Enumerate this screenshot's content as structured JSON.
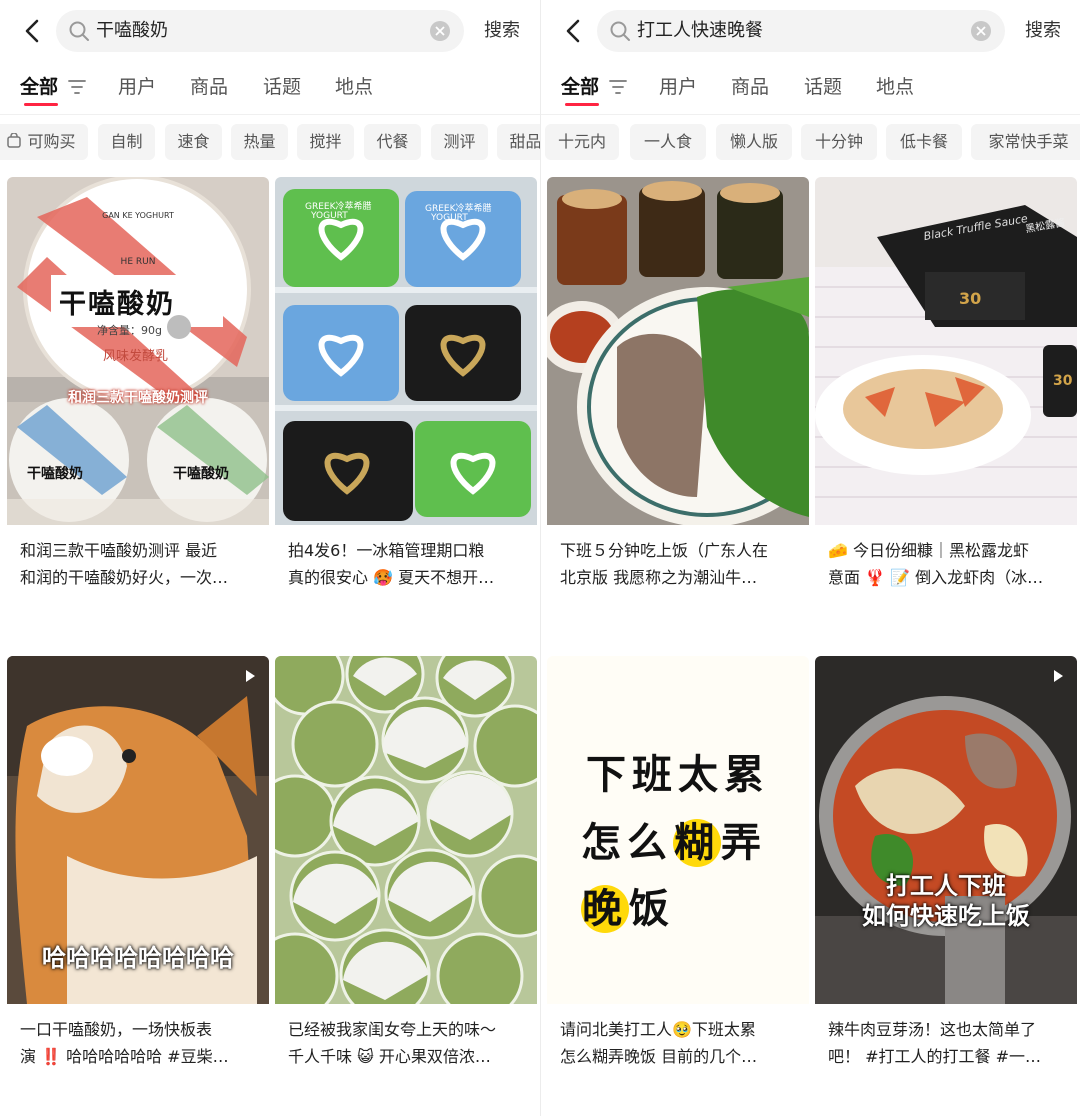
{
  "left": {
    "query": "干嗑酸奶",
    "search_label": "搜索",
    "tabs": [
      "全部",
      "用户",
      "商品",
      "话题",
      "地点"
    ],
    "chips": [
      "可购买",
      "自制",
      "速食",
      "热量",
      "搅拌",
      "代餐",
      "测评",
      "甜品"
    ],
    "cards": [
      {
        "title": "和润三款干嗑酸奶测评 最近\n和润的干嗑酸奶好火，一次…",
        "overlay": {
          "lid_main": "干嗑酸奶",
          "lid_en": "GAN KE YOGHURT",
          "brand": "HE RUN",
          "net": "净含量：90g",
          "flavor": "风味发酵乳",
          "banner": "和润三款干嗑酸奶测评",
          "small_lid": "干嗑酸奶"
        }
      },
      {
        "title": "拍4发6！一冰箱管理期口粮\n真的很安心 🥵 夏天不想开…",
        "overlay": {
          "brand": "GREEK冷萃希腊",
          "product": "YOGURT"
        }
      },
      {
        "title": "一口干嗑酸奶，一场快板表\n演 ‼️ 哈哈哈哈哈哈 #豆柴…",
        "overlay": {
          "caption": "哈哈哈哈哈哈哈哈"
        }
      },
      {
        "title": "已经被我家闺女夸上天的味～\n千人千味 😺 开心果双倍浓…",
        "overlay": {}
      }
    ]
  },
  "right": {
    "query": "打工人快速晚餐",
    "search_label": "搜索",
    "tabs": [
      "全部",
      "用户",
      "商品",
      "话题",
      "地点"
    ],
    "chips": [
      "十元内",
      "一人食",
      "懒人版",
      "十分钟",
      "低卡餐",
      "家常快手菜"
    ],
    "cards": [
      {
        "title": "下班５分钟吃上饭（广东人在\n北京版 我愿称之为潮汕牛…",
        "overlay": {}
      },
      {
        "title": "🧀 今日份细糠｜黑松露龙虾\n意面 🦞 📝 倒入龙虾肉（冰…",
        "overlay": {
          "box_en": "Black Truffle Sauce",
          "box_cn": "黑松露酱",
          "jar_num": "30"
        }
      },
      {
        "title": "请问北美打工人🥹下班太累\n怎么糊弄晚饭 目前的几个…",
        "overlay": {
          "line1": "下班太累",
          "line2a": "怎么",
          "line2b": "糊",
          "line2c": "弄",
          "line3a": "晚",
          "line3b": "饭"
        }
      },
      {
        "title": "辣牛肉豆芽汤！这也太简单了\n吧！ #打工人的打工餐 #一…",
        "overlay": {
          "cap1": "打工人下班",
          "cap2": "如何快速吃上饭"
        }
      }
    ]
  },
  "colors": {
    "accent": "#ff2442",
    "chip_bg": "#f4f4f4",
    "highlight": "#ffd90a"
  },
  "icons": [
    "back-arrow-icon",
    "search-icon",
    "clear-icon",
    "filter-icon",
    "cart-icon",
    "play-icon"
  ]
}
